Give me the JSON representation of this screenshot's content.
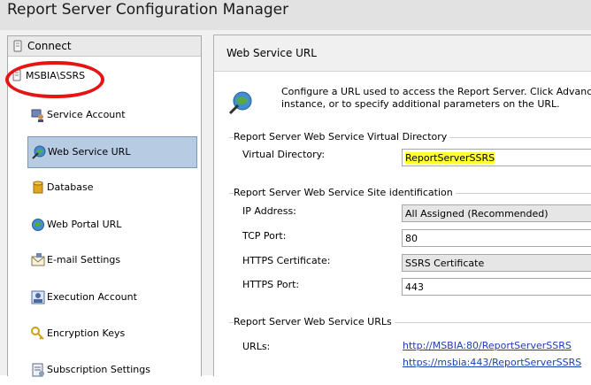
{
  "window": {
    "title": "Report Server Configuration Manager"
  },
  "sidebar": {
    "connect_label": "Connect",
    "server_name": "MSBIA\\SSRS",
    "items": [
      {
        "label": "Service Account",
        "icon": "service-account-icon"
      },
      {
        "label": "Web Service URL",
        "icon": "web-service-icon",
        "selected": true
      },
      {
        "label": "Database",
        "icon": "database-icon"
      },
      {
        "label": "Web Portal URL",
        "icon": "web-portal-icon"
      },
      {
        "label": "E-mail Settings",
        "icon": "email-icon"
      },
      {
        "label": "Execution Account",
        "icon": "execution-account-icon"
      },
      {
        "label": "Encryption Keys",
        "icon": "encryption-keys-icon"
      },
      {
        "label": "Subscription Settings",
        "icon": "subscription-settings-icon"
      }
    ]
  },
  "main": {
    "header": "Web Service URL",
    "description_line1": "Configure a URL used to access the Report Server.  Click Advanced to",
    "description_line2": "instance, or to specify additional parameters on the URL.",
    "virtual_directory_section": {
      "title": "Report Server Web Service Virtual Directory",
      "label": "Virtual Directory:",
      "value": "ReportServerSSRS"
    },
    "site_section": {
      "title": "Report Server Web Service Site identification",
      "ip_label": "IP Address:",
      "ip_value": "All Assigned (Recommended)",
      "tcp_label": "TCP Port:",
      "tcp_value": "80",
      "cert_label": "HTTPS Certificate:",
      "cert_value": "SSRS Certificate",
      "https_port_label": "HTTPS Port:",
      "https_port_value": "443"
    },
    "urls_section": {
      "title": "Report Server Web Service URLs",
      "label": "URLs:",
      "links": [
        "http://MSBIA:80/ReportServerSSRS",
        "https://msbia:443/ReportServerSSRS"
      ]
    }
  },
  "colors": {
    "selected_bg": "#b7cbe3",
    "highlight": "#ffff33",
    "annotation_ring": "#e51515",
    "link": "#1b3fb0"
  }
}
